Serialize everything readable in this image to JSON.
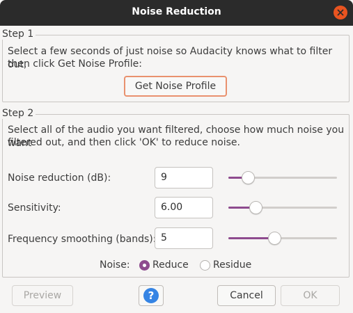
{
  "window": {
    "title": "Noise Reduction",
    "close_icon": "close-icon"
  },
  "step1": {
    "label": "Step 1",
    "description_line1": "Select a few seconds of just noise so Audacity knows what to filter out,",
    "description_line2": "then click Get Noise Profile:",
    "button_label": "Get Noise Profile"
  },
  "step2": {
    "label": "Step 2",
    "description_line1": "Select all of the audio you want filtered, choose how much noise you want",
    "description_line2": "filtered out, and then click 'OK' to reduce noise.",
    "noise_reduction": {
      "label": "Noise reduction (dB):",
      "value": "9",
      "slider_fraction": 0.18
    },
    "sensitivity": {
      "label": "Sensitivity:",
      "value": "6.00",
      "slider_fraction": 0.25
    },
    "frequency_smoothing": {
      "label": "Frequency smoothing (bands):",
      "value": "5",
      "slider_fraction": 0.42
    },
    "noise_mode": {
      "label": "Noise:",
      "options": [
        "Reduce",
        "Residue"
      ],
      "selected": "Reduce"
    }
  },
  "footer": {
    "preview_label": "Preview",
    "help_label": "?",
    "cancel_label": "Cancel",
    "ok_label": "OK"
  },
  "colors": {
    "accent": "#8e4b8e",
    "close": "#e95420",
    "help": "#3584e4",
    "titlebar": "#2b2b2b"
  }
}
